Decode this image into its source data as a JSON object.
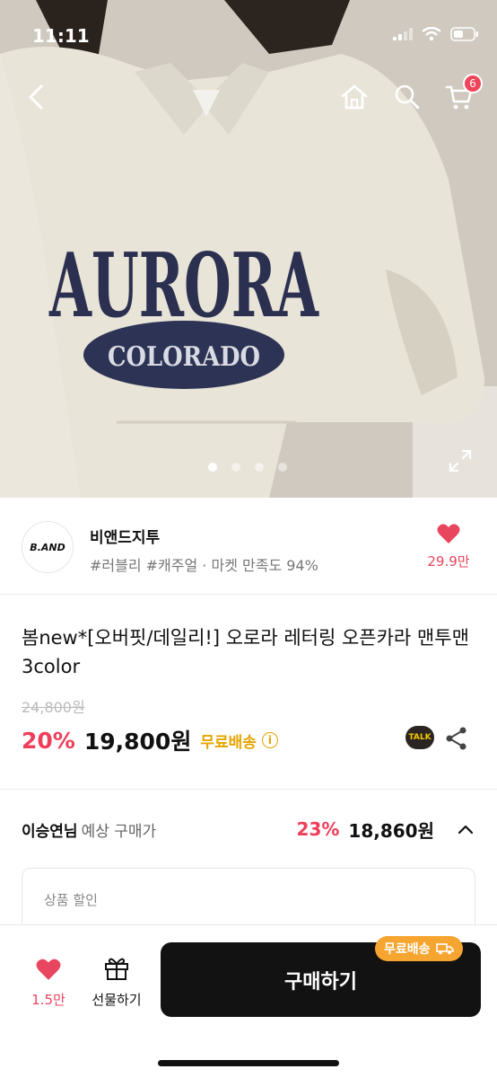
{
  "status_bar": {
    "time": "11:11"
  },
  "header": {
    "cart_count": "6"
  },
  "hero": {
    "print_top": "AURORA",
    "print_oval": "COLORADO",
    "image_count": 4,
    "active_index": 0
  },
  "shop": {
    "logo_text": "B.AND",
    "name": "비앤드지투",
    "tags": "#러블리 #캐주얼 · 마켓 만족도 94%",
    "like_count": "29.9만"
  },
  "product": {
    "title": "봄new*[오버핏/데일리!] 오로라 레터링 오픈카라 맨투맨 3color",
    "original_price": "24,800원",
    "discount": "20%",
    "price": "19,800원",
    "free_shipping": "무료배송",
    "info_icon": "i",
    "talk_label": "TALK"
  },
  "expected": {
    "user_name": "이승연님",
    "label": "예상 구매가",
    "discount": "23%",
    "price": "18,860원"
  },
  "discount_box": {
    "label": "상품 할인"
  },
  "bottom_bar": {
    "like_count": "1.5만",
    "gift_label": "선물하기",
    "buy_label": "구매하기",
    "ship_badge": "무료배송"
  },
  "colors": {
    "accent": "#ef3e5a",
    "ship": "#e6a400",
    "badge": "#f6a531",
    "button": "#121212"
  }
}
